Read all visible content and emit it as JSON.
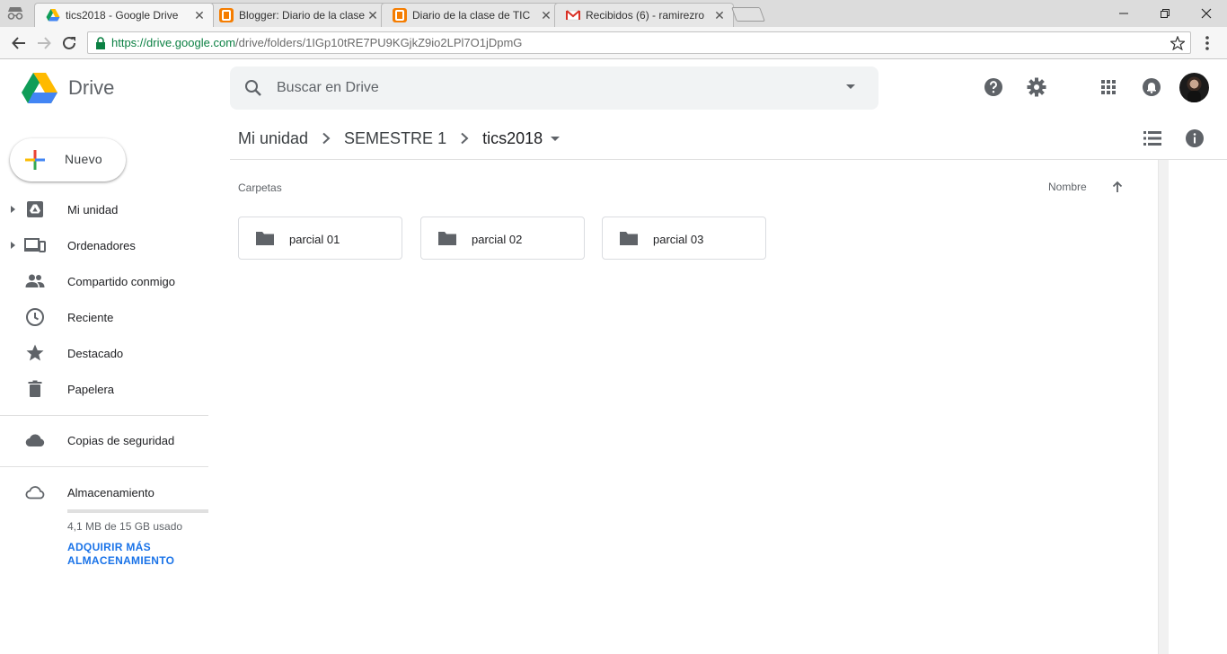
{
  "browser": {
    "tabs": [
      {
        "title": "tics2018 - Google Drive",
        "active": true,
        "favicon": "drive-icon"
      },
      {
        "title": "Blogger: Diario de la clase",
        "active": false,
        "favicon": "blogger-icon"
      },
      {
        "title": "Diario de la clase de TIC",
        "active": false,
        "favicon": "blogger-icon"
      },
      {
        "title": "Recibidos (6) - ramirezro",
        "active": false,
        "favicon": "gmail-icon"
      }
    ],
    "url_secure": "https://drive.google.com",
    "url_path": "/drive/folders/1IGp10tRE7PU9KGjkZ9io2LPl7O1jDpmG"
  },
  "header": {
    "app_name": "Drive",
    "search_placeholder": "Buscar en Drive"
  },
  "breadcrumb": [
    "Mi unidad",
    "SEMESTRE 1",
    "tics2018"
  ],
  "sidebar": {
    "new_label": "Nuevo",
    "items": [
      {
        "label": "Mi unidad",
        "icon": "my-drive-icon",
        "expandable": true
      },
      {
        "label": "Ordenadores",
        "icon": "computers-icon",
        "expandable": true
      },
      {
        "label": "Compartido conmigo",
        "icon": "shared-icon",
        "expandable": false
      },
      {
        "label": "Reciente",
        "icon": "clock-icon",
        "expandable": false
      },
      {
        "label": "Destacado",
        "icon": "star-icon",
        "expandable": false
      },
      {
        "label": "Papelera",
        "icon": "trash-icon",
        "expandable": false
      }
    ],
    "backups_label": "Copias de seguridad",
    "storage_label": "Almacenamiento",
    "storage_used": "4,1 MB de 15 GB usado",
    "storage_fraction": 0.0003,
    "buy_storage": "ADQUIRIR MÁS ALMACENAMIENTO"
  },
  "main": {
    "section_title": "Carpetas",
    "sort_label": "Nombre",
    "folders": [
      "parcial 01",
      "parcial 02",
      "parcial 03"
    ]
  },
  "colors": {
    "accent": "#1a73e8",
    "icon_gray": "#5f6368"
  }
}
